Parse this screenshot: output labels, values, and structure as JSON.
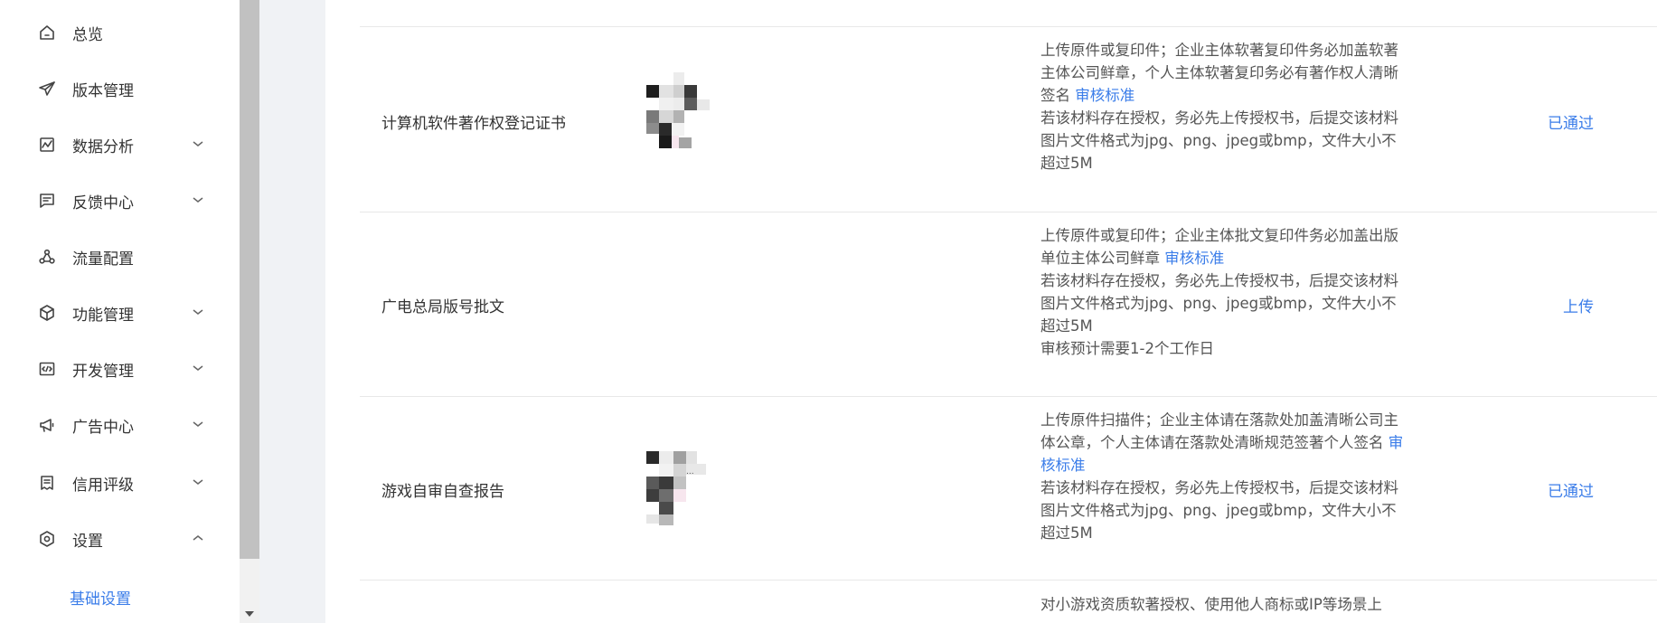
{
  "sidebar": {
    "items": [
      {
        "label": "总览",
        "icon": "home-icon"
      },
      {
        "label": "版本管理",
        "icon": "send-icon"
      },
      {
        "label": "数据分析",
        "icon": "chart-icon",
        "chevron": "down"
      },
      {
        "label": "反馈中心",
        "icon": "message-icon",
        "chevron": "down"
      },
      {
        "label": "流量配置",
        "icon": "share-icon"
      },
      {
        "label": "功能管理",
        "icon": "cube-icon",
        "chevron": "down"
      },
      {
        "label": "开发管理",
        "icon": "code-icon",
        "chevron": "down"
      },
      {
        "label": "广告中心",
        "icon": "megaphone-icon",
        "chevron": "down"
      },
      {
        "label": "信用评级",
        "icon": "document-icon",
        "chevron": "down"
      },
      {
        "label": "设置",
        "icon": "gear-icon",
        "chevron": "up"
      }
    ],
    "sub_items": [
      {
        "label": "基础设置"
      }
    ]
  },
  "materials": [
    {
      "name": "计算机软件著作权登记证书",
      "has_thumbnail": true,
      "desc": {
        "line1": "上传原件或复印件；企业主体软著复印件务必加盖软著主体公司鲜章，个人主体软著复印务必有著作权人清晰签名",
        "link": "审核标准",
        "line2": "若该材料存在授权，务必先上传授权书，后提交该材料",
        "line3": "图片文件格式为jpg、png、jpeg或bmp，文件大小不超过5M",
        "line4": ""
      },
      "status": "已通过"
    },
    {
      "name": "广电总局版号批文",
      "has_thumbnail": false,
      "desc": {
        "line1": "上传原件或复印件；企业主体批文复印件务必加盖出版单位主体公司鲜章",
        "link": "审核标准",
        "line2": "若该材料存在授权，务必先上传授权书，后提交该材料",
        "line3": "图片文件格式为jpg、png、jpeg或bmp，文件大小不超过5M",
        "line4": "审核预计需要1-2个工作日"
      },
      "status": "上传"
    },
    {
      "name": "游戏自审自查报告",
      "has_thumbnail": true,
      "desc": {
        "line1": "上传原件扫描件；企业主体请在落款处加盖清晰公司主体公章，个人主体请在落款处清晰规范签著个人签名",
        "link": "审核标准",
        "line2": "若该材料存在授权，务必先上传授权书，后提交该材料",
        "line3": "图片文件格式为jpg、png、jpeg或bmp，文件大小不超过5M",
        "line4": ""
      },
      "status": "已通过"
    }
  ],
  "partial_row": {
    "line1": "对小游戏资质软著授权、使用他人商标或IP等场景上"
  },
  "colors": {
    "accent": "#3b7de9",
    "gutter": "#f0f2f5",
    "scroll_thumb": "#c1c1c1"
  }
}
